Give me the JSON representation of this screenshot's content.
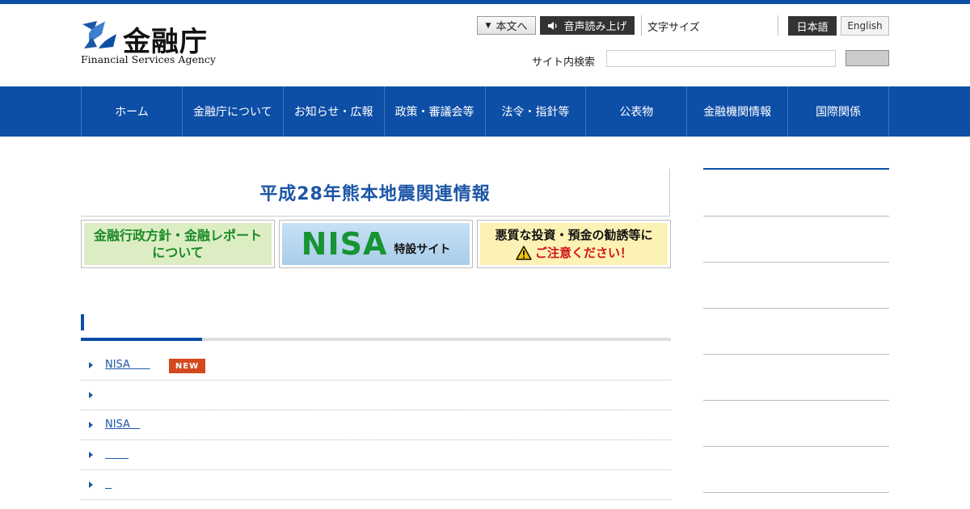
{
  "header": {
    "logo_jp": "金融庁",
    "logo_en": "Financial Services Agency",
    "skip_label": "本文へ",
    "voice_label": "音声読み上げ",
    "font_size_label": "文字サイズ",
    "lang_ja": "日本語",
    "lang_en": "English",
    "search_label": "サイト内検索",
    "search_value": ""
  },
  "nav": {
    "items": [
      "ホーム",
      "金融庁について",
      "お知らせ・広報",
      "政策・審議会等",
      "法令・指針等",
      "公表物",
      "金融機関情報",
      "国際関係"
    ]
  },
  "main": {
    "quake_banner": "平成28年熊本地震関連情報",
    "banners": {
      "policy_line1": "金融行政方針・金融レポート",
      "policy_line2": "について",
      "nisa_title": "NISA",
      "nisa_sub": "特設サイト",
      "warning_line1": "悪質な投資・預金の勧誘等に",
      "warning_line2": "ご注意ください！"
    },
    "news": [
      {
        "text": "NISA      ",
        "badge": "NEW"
      },
      {
        "text": "",
        "badge": ""
      },
      {
        "text": "NISA   ",
        "badge": ""
      },
      {
        "text": "       ",
        "badge": ""
      },
      {
        "text": "  ",
        "badge": ""
      }
    ]
  },
  "colors": {
    "brand_blue": "#0d4ea6",
    "link_blue": "#1c56a6",
    "new_badge": "#d2491d",
    "nisa_green": "#179433"
  }
}
